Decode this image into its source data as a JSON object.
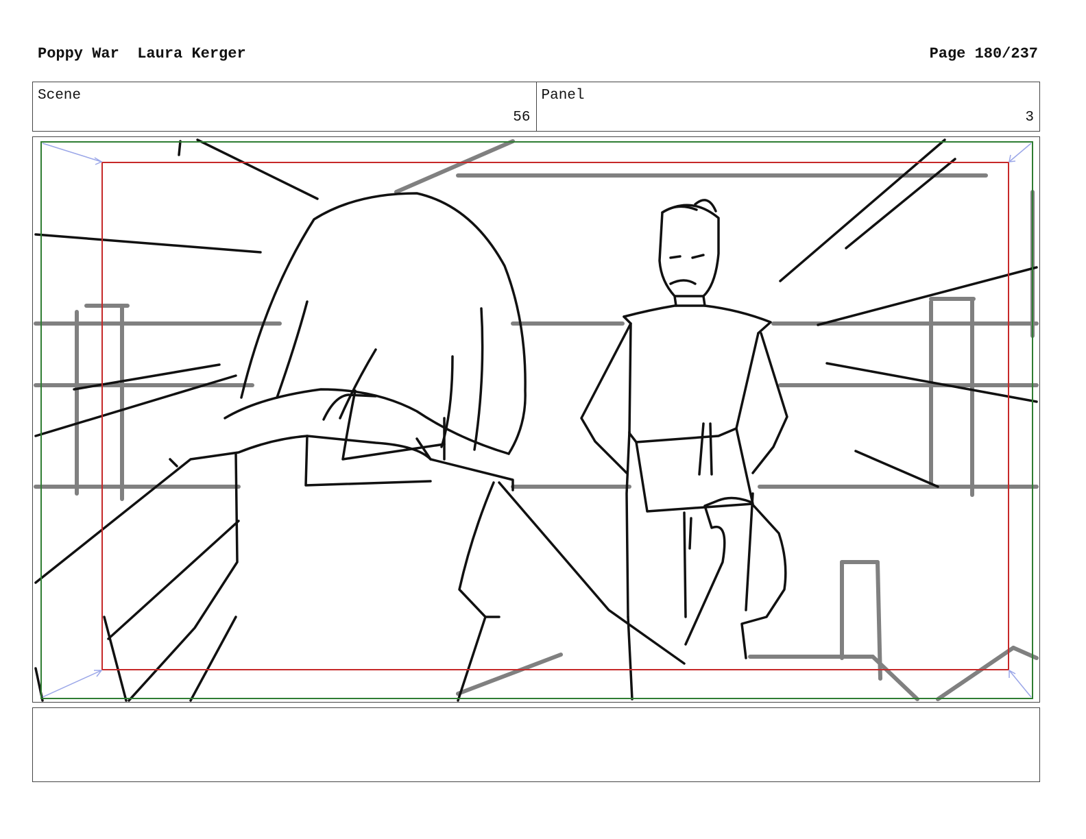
{
  "header": {
    "project": "Poppy War",
    "artist": "Laura Kerger",
    "page": "Page 180/237"
  },
  "scene": {
    "label": "Scene",
    "value": "56"
  },
  "panel": {
    "label": "Panel",
    "value": "3"
  },
  "caption": {
    "text": ""
  },
  "colors": {
    "safe_area": "#2e7d32",
    "action_area": "#c62828",
    "guide_arrow": "#9aa6e8",
    "ink": "#111111",
    "background_ink": "#808080"
  }
}
